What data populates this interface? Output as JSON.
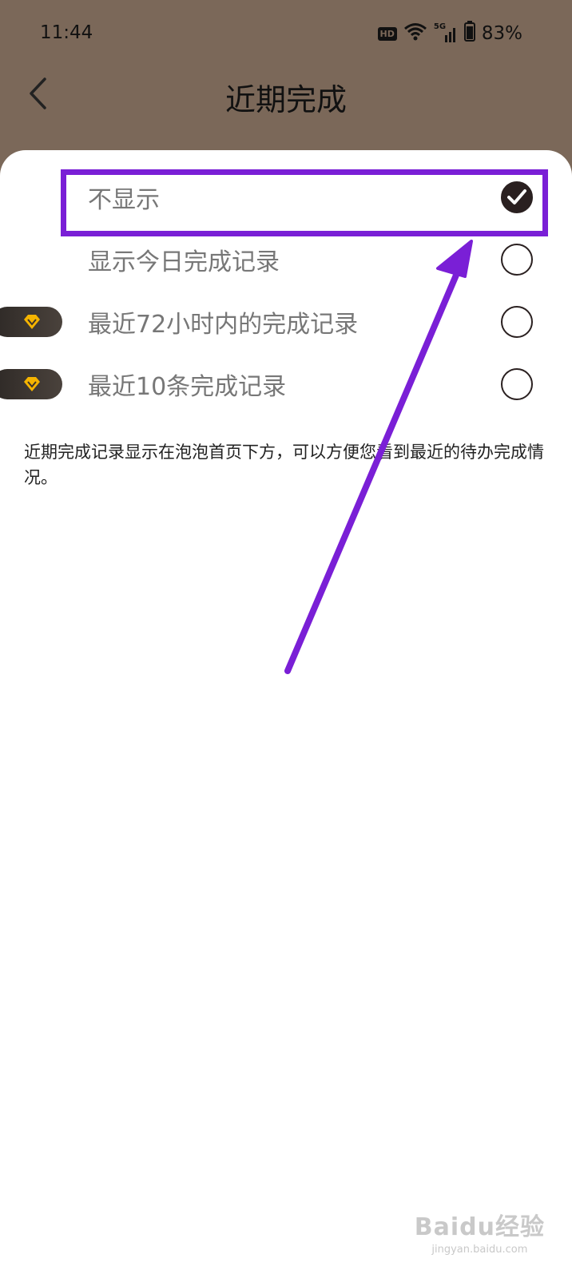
{
  "status": {
    "time": "11:44",
    "hd": "HD",
    "network": "5G",
    "battery": "83%"
  },
  "header": {
    "title": "近期完成"
  },
  "options": [
    {
      "label": "不显示",
      "selected": true,
      "vip": false
    },
    {
      "label": "显示今日完成记录",
      "selected": false,
      "vip": false
    },
    {
      "label": "最近72小时内的完成记录",
      "selected": false,
      "vip": true
    },
    {
      "label": "最近10条完成记录",
      "selected": false,
      "vip": true
    }
  ],
  "description": "近期完成记录显示在泡泡首页下方，可以方便您看到最近的待办完成情况。",
  "watermark": {
    "brand": "Baidu经验",
    "url": "jingyan.baidu.com"
  },
  "colors": {
    "header_bg": "#7b6859",
    "annotation": "#7a1fd6",
    "radio": "#2a2020",
    "vip_gem": "#f5b400"
  }
}
